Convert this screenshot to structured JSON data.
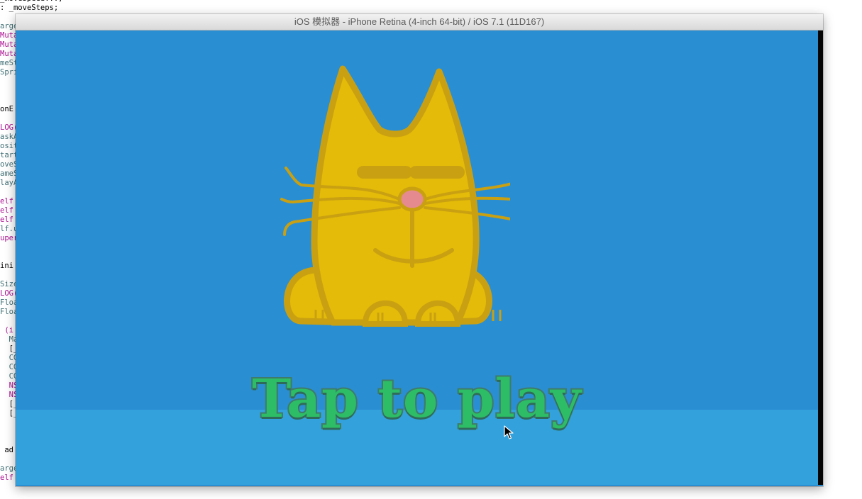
{
  "window": {
    "title": "iOS 模拟器 - iPhone Retina (4-inch 64-bit) / iOS 7.1 (11D167)"
  },
  "game": {
    "prompt": "Tap to play"
  },
  "background_code": [
    {
      "text": "_moveSteps;",
      "cls": "c-dark",
      "prefix": ": "
    },
    {
      "text": "arget",
      "cls": "c-teal"
    },
    {
      "text": "Muta",
      "cls": "c-purple"
    },
    {
      "text": "Muta",
      "cls": "c-purple"
    },
    {
      "text": "Muta",
      "cls": "c-purple"
    },
    {
      "text": "meSt",
      "cls": "c-teal"
    },
    {
      "text": "Spri",
      "cls": "c-teal"
    },
    {
      "text": "onE",
      "cls": "c-dark"
    },
    {
      "text": "LOG(",
      "cls": "c-purple"
    },
    {
      "text": "askA",
      "cls": "c-teal"
    },
    {
      "text": "osit",
      "cls": "c-teal"
    },
    {
      "text": "tart",
      "cls": "c-teal"
    },
    {
      "text": "oveS",
      "cls": "c-teal"
    },
    {
      "text": "ameS",
      "cls": "c-teal"
    },
    {
      "text": "layA",
      "cls": "c-teal"
    },
    {
      "text": "elf",
      "cls": "c-purple"
    },
    {
      "text": "elf",
      "cls": "c-purple"
    },
    {
      "text": "elf",
      "cls": "c-purple"
    },
    {
      "text": "lf.u",
      "cls": "c-teal"
    },
    {
      "text": "uper",
      "cls": "c-purple"
    },
    {
      "text": "ini",
      "cls": "c-dark"
    },
    {
      "text": "Size",
      "cls": "c-teal"
    },
    {
      "text": "LOG(",
      "cls": "c-purple"
    },
    {
      "text": "Floa",
      "cls": "c-teal"
    },
    {
      "text": "Floa",
      "cls": "c-teal"
    },
    {
      "text": " (i",
      "cls": "c-purple"
    },
    {
      "text": "  Ma",
      "cls": "c-teal"
    },
    {
      "text": "  [_",
      "cls": "c-dark"
    },
    {
      "text": "  CG",
      "cls": "c-teal"
    },
    {
      "text": "  CG",
      "cls": "c-teal"
    },
    {
      "text": "  CG",
      "cls": "c-teal"
    },
    {
      "text": "  NS",
      "cls": "c-purple"
    },
    {
      "text": "  NS",
      "cls": "c-purple"
    },
    {
      "text": "  [_",
      "cls": "c-dark"
    },
    {
      "text": "  [_",
      "cls": "c-dark"
    },
    {
      "text": " ad",
      "cls": "c-dark"
    },
    {
      "text": "arge",
      "cls": "c-teal"
    },
    {
      "text": "elf",
      "cls": "c-purple"
    }
  ],
  "colors": {
    "sky": "#2a8ed3",
    "ground": "#33a1dc",
    "cat_body": "#e3bb08",
    "cat_outline": "#c9a011",
    "cat_nose": "#e58b8f",
    "prompt_fill": "#2dbd66",
    "prompt_outline": "#3f7b6a"
  },
  "icons": {
    "cat": "cat-character-icon",
    "cursor": "mouse-pointer-icon"
  }
}
